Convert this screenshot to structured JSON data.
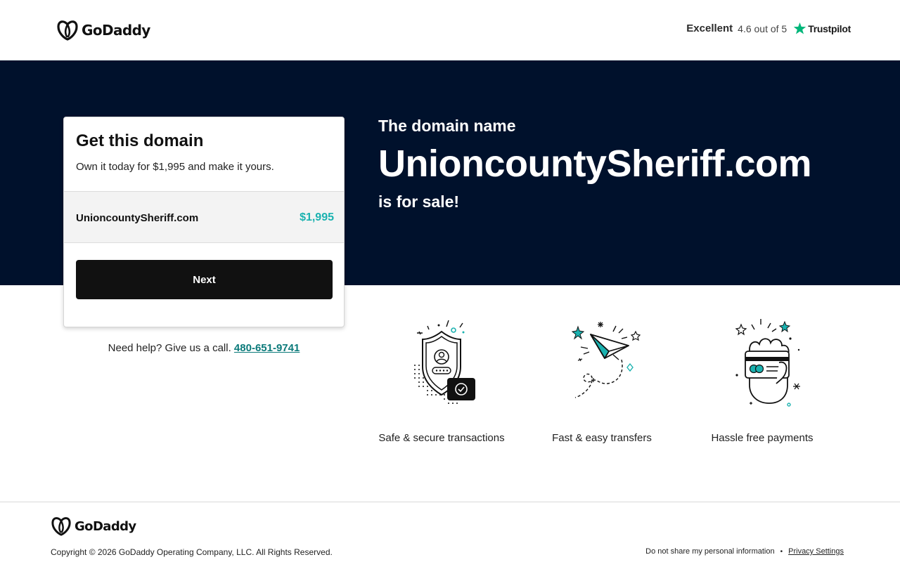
{
  "header": {
    "logo_text": "GoDaddy",
    "trustpilot": {
      "label": "Excellent",
      "rating": "4.6 out of 5",
      "brand": "Trustpilot"
    }
  },
  "hero": {
    "kicker": "The domain name",
    "domain": "UnioncountySheriff.com",
    "suffix": "is for sale!"
  },
  "card": {
    "title": "Get this domain",
    "subtitle": "Own it today for $1,995 and make it yours.",
    "domain": "UnioncountySheriff.com",
    "price": "$1,995",
    "button_label": "Next"
  },
  "help": {
    "text": "Need help? Give us a call.",
    "phone": "480-651-9741"
  },
  "features": [
    {
      "label": "Safe & secure transactions",
      "icon": "shield-lock-icon"
    },
    {
      "label": "Fast & easy transfers",
      "icon": "paper-plane-icon"
    },
    {
      "label": "Hassle free payments",
      "icon": "hand-card-icon"
    }
  ],
  "footer": {
    "logo_text": "GoDaddy",
    "copyright": "Copyright © 2026 GoDaddy Operating Company, LLC. All Rights Reserved.",
    "do_not_share": "Do not share my personal information",
    "separator": "•",
    "privacy": "Privacy Settings"
  },
  "colors": {
    "hero_bg": "#00112c",
    "accent_teal": "#1bb2b0",
    "button_bg": "#111111",
    "trustpilot_green": "#00b67a"
  }
}
